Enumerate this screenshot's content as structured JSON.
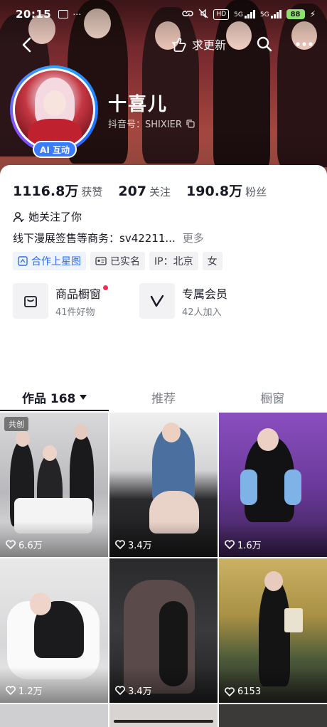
{
  "status_bar": {
    "time": "20:15",
    "hd_label": "HD",
    "network_1": "5G",
    "network_2": "5G",
    "battery": "88"
  },
  "nav": {
    "update_label": "求更新"
  },
  "profile": {
    "ai_badge": "AI 互动",
    "nickname": "十喜儿",
    "douyin_id": "抖音号：SHIXIER"
  },
  "stats": [
    {
      "value": "1116.8万",
      "label": "获赞"
    },
    {
      "value": "207",
      "label": "关注"
    },
    {
      "value": "190.8万",
      "label": "粉丝"
    }
  ],
  "follows_you": "她关注了你",
  "bio": {
    "text": "线下漫展签售等商务：sv42211...",
    "more": "更多"
  },
  "tags": [
    {
      "label": "合作上星图",
      "icon": "xingtu-icon",
      "highlight": true
    },
    {
      "label": "已实名",
      "icon": "id-card-icon",
      "highlight": false
    },
    {
      "label": "IP：北京",
      "icon": "",
      "highlight": false
    },
    {
      "label": "女",
      "icon": "",
      "highlight": false
    }
  ],
  "shop_entries": [
    {
      "title": "商品橱窗",
      "subtitle": "41件好物",
      "icon": "shopping-bag-icon",
      "has_dot": true
    },
    {
      "title": "专属会员",
      "subtitle": "42人加入",
      "icon": "vip-v-icon",
      "has_dot": false
    }
  ],
  "tabs": [
    {
      "label": "作品 168",
      "active": true
    },
    {
      "label": "推荐",
      "active": false
    },
    {
      "label": "橱窗",
      "active": false
    }
  ],
  "videos": [
    {
      "likes": "6.6万",
      "badge": "共创"
    },
    {
      "likes": "3.4万",
      "badge": ""
    },
    {
      "likes": "1.6万",
      "badge": ""
    },
    {
      "likes": "1.2万",
      "badge": ""
    },
    {
      "likes": "3.4万",
      "badge": ""
    },
    {
      "likes": "6153",
      "badge": ""
    }
  ],
  "colors": {
    "accent_red": "#fe2c55",
    "link_blue": "#2c6fe8",
    "ai_badge_blue": "#3b7bff",
    "text_primary": "#161823",
    "text_secondary": "#7a7e84"
  }
}
